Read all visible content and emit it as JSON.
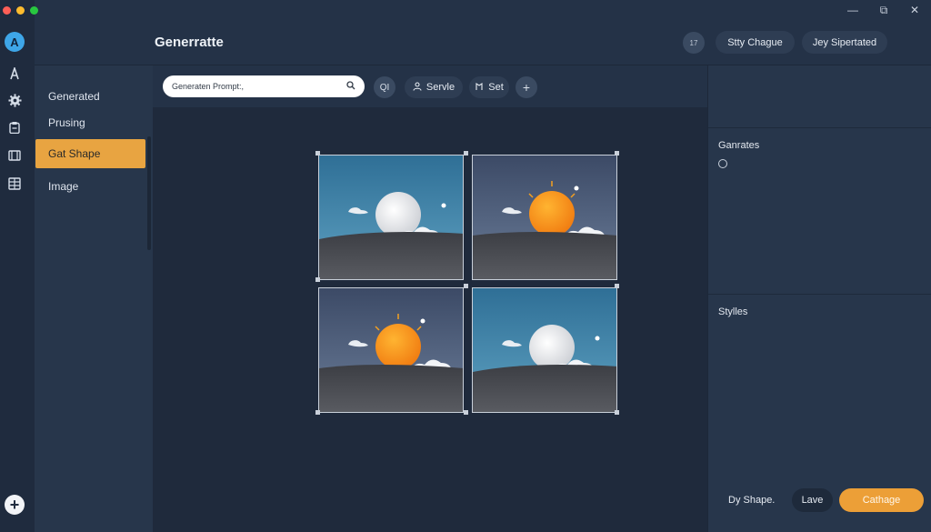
{
  "colors": {
    "accent": "#e8a441",
    "primary_button": "#ec9f37",
    "background": "#243247",
    "canvas": "#1f2a3c",
    "close": "#ff5f57",
    "minimize": "#febc2e",
    "zoom": "#28c840"
  },
  "window": {
    "controls": {
      "minimize": "—",
      "restore": "⧉",
      "close": "✕"
    }
  },
  "rail": {
    "logo": "A",
    "icons": [
      "text-tool-icon",
      "gear-icon",
      "clipboard-icon",
      "film-icon",
      "grid-icon"
    ],
    "add": "+"
  },
  "sidebar": {
    "items": [
      {
        "label": "Generated"
      },
      {
        "label": "Prusing"
      },
      {
        "label": "Gat Shape",
        "active": true
      },
      {
        "label": "Image"
      }
    ]
  },
  "header": {
    "title": "Generratte",
    "small_button": "17",
    "buttons": [
      "Stty Chague",
      "Jey Sipertated"
    ]
  },
  "toolbar": {
    "search_placeholder": "Generaten Prompt:,",
    "qi_label": "QI",
    "serve_label": "Servle",
    "set_label": "Set",
    "add_label": "+"
  },
  "canvas": {
    "images": [
      {
        "variant": "white-sun-blue-sky"
      },
      {
        "variant": "orange-sun-dusk-sky"
      },
      {
        "variant": "orange-sun-dusk-sky"
      },
      {
        "variant": "white-sun-blue-sky"
      }
    ]
  },
  "right_panel": {
    "section1_title": "Ganrates",
    "section2_title": "Stylles",
    "footer_label": "Dy Shape.",
    "leave_label": "Lave",
    "primary_label": "Cathage"
  }
}
